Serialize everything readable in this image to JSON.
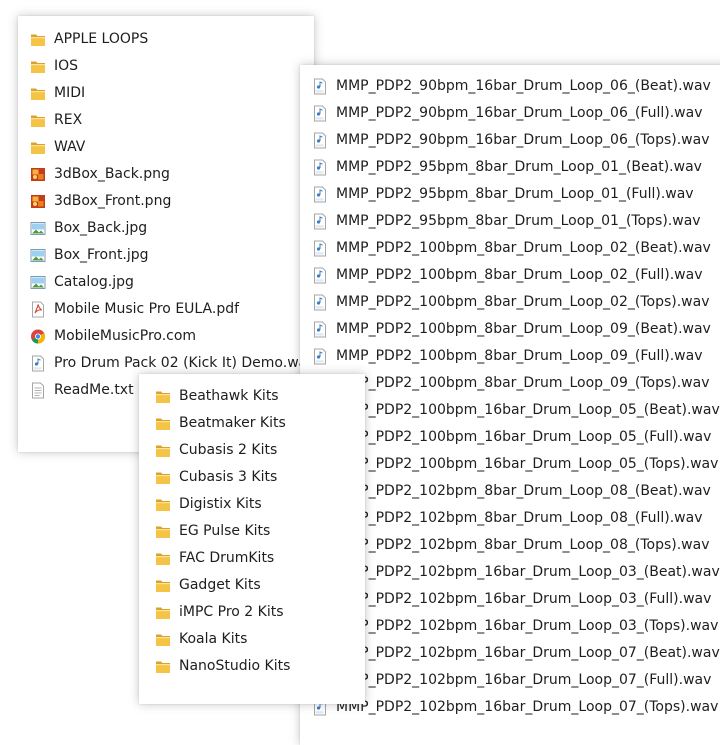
{
  "root_folder": {
    "items": [
      {
        "label": "APPLE LOOPS",
        "icon": "folder-icon"
      },
      {
        "label": "IOS",
        "icon": "folder-icon"
      },
      {
        "label": "MIDI",
        "icon": "folder-icon"
      },
      {
        "label": "REX",
        "icon": "folder-icon"
      },
      {
        "label": "WAV",
        "icon": "folder-icon"
      },
      {
        "label": "3dBox_Back.png",
        "icon": "png-image-icon"
      },
      {
        "label": "3dBox_Front.png",
        "icon": "png-image-icon"
      },
      {
        "label": "Box_Back.jpg",
        "icon": "jpg-image-icon"
      },
      {
        "label": "Box_Front.jpg",
        "icon": "jpg-image-icon"
      },
      {
        "label": "Catalog.jpg",
        "icon": "jpg-image-icon"
      },
      {
        "label": "Mobile Music Pro EULA.pdf",
        "icon": "pdf-file-icon"
      },
      {
        "label": "MobileMusicPro.com",
        "icon": "chrome-shortcut-icon"
      },
      {
        "label": "Pro Drum Pack 02 (Kick It) Demo.wav",
        "icon": "wav-audio-icon"
      },
      {
        "label": "ReadMe.txt",
        "icon": "text-file-icon"
      }
    ]
  },
  "wav_folder": {
    "items": [
      {
        "label": "MMP_PDP2_90bpm_16bar_Drum_Loop_06_(Beat).wav",
        "icon": "wav-audio-icon"
      },
      {
        "label": "MMP_PDP2_90bpm_16bar_Drum_Loop_06_(Full).wav",
        "icon": "wav-audio-icon"
      },
      {
        "label": "MMP_PDP2_90bpm_16bar_Drum_Loop_06_(Tops).wav",
        "icon": "wav-audio-icon"
      },
      {
        "label": "MMP_PDP2_95bpm_8bar_Drum_Loop_01_(Beat).wav",
        "icon": "wav-audio-icon"
      },
      {
        "label": "MMP_PDP2_95bpm_8bar_Drum_Loop_01_(Full).wav",
        "icon": "wav-audio-icon"
      },
      {
        "label": "MMP_PDP2_95bpm_8bar_Drum_Loop_01_(Tops).wav",
        "icon": "wav-audio-icon"
      },
      {
        "label": "MMP_PDP2_100bpm_8bar_Drum_Loop_02_(Beat).wav",
        "icon": "wav-audio-icon"
      },
      {
        "label": "MMP_PDP2_100bpm_8bar_Drum_Loop_02_(Full).wav",
        "icon": "wav-audio-icon"
      },
      {
        "label": "MMP_PDP2_100bpm_8bar_Drum_Loop_02_(Tops).wav",
        "icon": "wav-audio-icon"
      },
      {
        "label": "MMP_PDP2_100bpm_8bar_Drum_Loop_09_(Beat).wav",
        "icon": "wav-audio-icon"
      },
      {
        "label": "MMP_PDP2_100bpm_8bar_Drum_Loop_09_(Full).wav",
        "icon": "wav-audio-icon"
      },
      {
        "label": "MMP_PDP2_100bpm_8bar_Drum_Loop_09_(Tops).wav",
        "icon": "wav-audio-icon"
      },
      {
        "label": "MMP_PDP2_100bpm_16bar_Drum_Loop_05_(Beat).wav",
        "icon": "wav-audio-icon"
      },
      {
        "label": "MMP_PDP2_100bpm_16bar_Drum_Loop_05_(Full).wav",
        "icon": "wav-audio-icon"
      },
      {
        "label": "MMP_PDP2_100bpm_16bar_Drum_Loop_05_(Tops).wav",
        "icon": "wav-audio-icon"
      },
      {
        "label": "MMP_PDP2_102bpm_8bar_Drum_Loop_08_(Beat).wav",
        "icon": "wav-audio-icon"
      },
      {
        "label": "MMP_PDP2_102bpm_8bar_Drum_Loop_08_(Full).wav",
        "icon": "wav-audio-icon"
      },
      {
        "label": "MMP_PDP2_102bpm_8bar_Drum_Loop_08_(Tops).wav",
        "icon": "wav-audio-icon"
      },
      {
        "label": "MMP_PDP2_102bpm_16bar_Drum_Loop_03_(Beat).wav",
        "icon": "wav-audio-icon"
      },
      {
        "label": "MMP_PDP2_102bpm_16bar_Drum_Loop_03_(Full).wav",
        "icon": "wav-audio-icon"
      },
      {
        "label": "MMP_PDP2_102bpm_16bar_Drum_Loop_03_(Tops).wav",
        "icon": "wav-audio-icon"
      },
      {
        "label": "MMP_PDP2_102bpm_16bar_Drum_Loop_07_(Beat).wav",
        "icon": "wav-audio-icon"
      },
      {
        "label": "MMP_PDP2_102bpm_16bar_Drum_Loop_07_(Full).wav",
        "icon": "wav-audio-icon"
      },
      {
        "label": "MMP_PDP2_102bpm_16bar_Drum_Loop_07_(Tops).wav",
        "icon": "wav-audio-icon"
      }
    ]
  },
  "ios_folder": {
    "items": [
      {
        "label": "Beathawk Kits",
        "icon": "folder-icon"
      },
      {
        "label": "Beatmaker Kits",
        "icon": "folder-icon"
      },
      {
        "label": "Cubasis 2 Kits",
        "icon": "folder-icon"
      },
      {
        "label": "Cubasis 3 Kits",
        "icon": "folder-icon"
      },
      {
        "label": "Digistix Kits",
        "icon": "folder-icon"
      },
      {
        "label": "EG Pulse Kits",
        "icon": "folder-icon"
      },
      {
        "label": "FAC DrumKits",
        "icon": "folder-icon"
      },
      {
        "label": "Gadget Kits",
        "icon": "folder-icon"
      },
      {
        "label": "iMPC Pro 2 Kits",
        "icon": "folder-icon"
      },
      {
        "label": "Koala Kits",
        "icon": "folder-icon"
      },
      {
        "label": "NanoStudio Kits",
        "icon": "folder-icon"
      }
    ]
  },
  "colors": {
    "folder": "#f5c446",
    "folder_dark": "#dba12b",
    "text": "#1e1e1e"
  }
}
